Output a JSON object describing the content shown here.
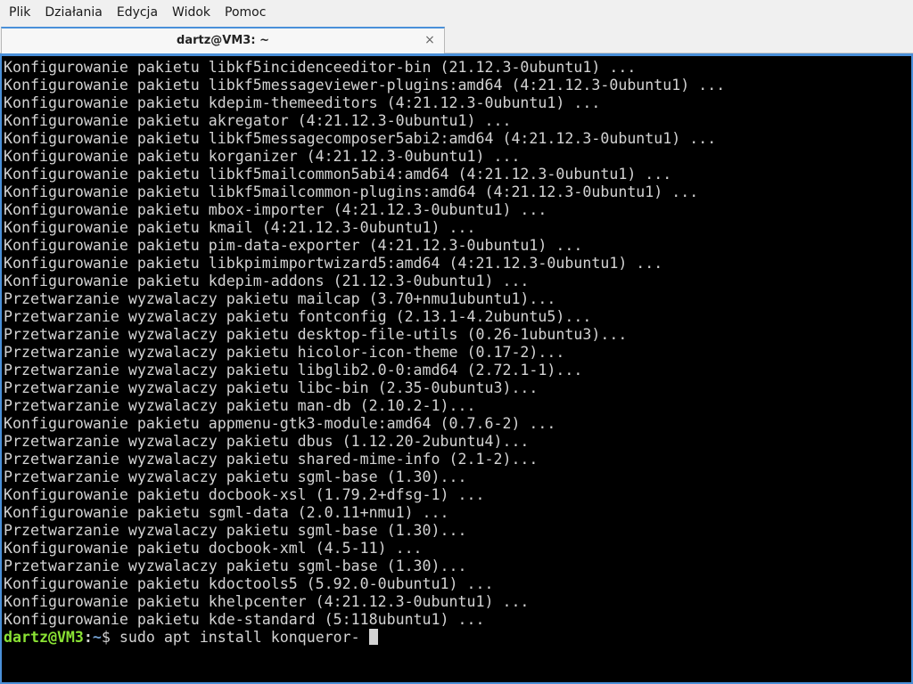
{
  "menu": {
    "items": [
      "Plik",
      "Działania",
      "Edycja",
      "Widok",
      "Pomoc"
    ]
  },
  "tab": {
    "title": "dartz@VM3: ~",
    "close_icon": "×"
  },
  "terminal": {
    "lines": [
      "Konfigurowanie pakietu libkf5incidenceeditor-bin (21.12.3-0ubuntu1) ...",
      "Konfigurowanie pakietu libkf5messageviewer-plugins:amd64 (4:21.12.3-0ubuntu1) ...",
      "Konfigurowanie pakietu kdepim-themeeditors (4:21.12.3-0ubuntu1) ...",
      "Konfigurowanie pakietu akregator (4:21.12.3-0ubuntu1) ...",
      "Konfigurowanie pakietu libkf5messagecomposer5abi2:amd64 (4:21.12.3-0ubuntu1) ...",
      "Konfigurowanie pakietu korganizer (4:21.12.3-0ubuntu1) ...",
      "Konfigurowanie pakietu libkf5mailcommon5abi4:amd64 (4:21.12.3-0ubuntu1) ...",
      "Konfigurowanie pakietu libkf5mailcommon-plugins:amd64 (4:21.12.3-0ubuntu1) ...",
      "Konfigurowanie pakietu mbox-importer (4:21.12.3-0ubuntu1) ...",
      "Konfigurowanie pakietu kmail (4:21.12.3-0ubuntu1) ...",
      "Konfigurowanie pakietu pim-data-exporter (4:21.12.3-0ubuntu1) ...",
      "Konfigurowanie pakietu libkpimimportwizard5:amd64 (4:21.12.3-0ubuntu1) ...",
      "Konfigurowanie pakietu kdepim-addons (21.12.3-0ubuntu1) ...",
      "Przetwarzanie wyzwalaczy pakietu mailcap (3.70+nmu1ubuntu1)...",
      "Przetwarzanie wyzwalaczy pakietu fontconfig (2.13.1-4.2ubuntu5)...",
      "Przetwarzanie wyzwalaczy pakietu desktop-file-utils (0.26-1ubuntu3)...",
      "Przetwarzanie wyzwalaczy pakietu hicolor-icon-theme (0.17-2)...",
      "Przetwarzanie wyzwalaczy pakietu libglib2.0-0:amd64 (2.72.1-1)...",
      "Przetwarzanie wyzwalaczy pakietu libc-bin (2.35-0ubuntu3)...",
      "Przetwarzanie wyzwalaczy pakietu man-db (2.10.2-1)...",
      "Konfigurowanie pakietu appmenu-gtk3-module:amd64 (0.7.6-2) ...",
      "Przetwarzanie wyzwalaczy pakietu dbus (1.12.20-2ubuntu4)...",
      "Przetwarzanie wyzwalaczy pakietu shared-mime-info (2.1-2)...",
      "Przetwarzanie wyzwalaczy pakietu sgml-base (1.30)...",
      "Konfigurowanie pakietu docbook-xsl (1.79.2+dfsg-1) ...",
      "Konfigurowanie pakietu sgml-data (2.0.11+nmu1) ...",
      "Przetwarzanie wyzwalaczy pakietu sgml-base (1.30)...",
      "Konfigurowanie pakietu docbook-xml (4.5-11) ...",
      "Przetwarzanie wyzwalaczy pakietu sgml-base (1.30)...",
      "Konfigurowanie pakietu kdoctools5 (5.92.0-0ubuntu1) ...",
      "Konfigurowanie pakietu khelpcenter (4:21.12.3-0ubuntu1) ...",
      "Konfigurowanie pakietu kde-standard (5:118ubuntu1) ..."
    ],
    "prompt": {
      "user_host": "dartz@VM3",
      "separator": ":",
      "path": "~",
      "dollar": "$ ",
      "command": "sudo apt install konqueror- "
    }
  },
  "colors": {
    "terminal_bg": "#000000",
    "terminal_fg": "#d3d3d3",
    "prompt_user": "#8ae234",
    "prompt_path": "#729fcf",
    "focus_border": "#4a90d9"
  }
}
